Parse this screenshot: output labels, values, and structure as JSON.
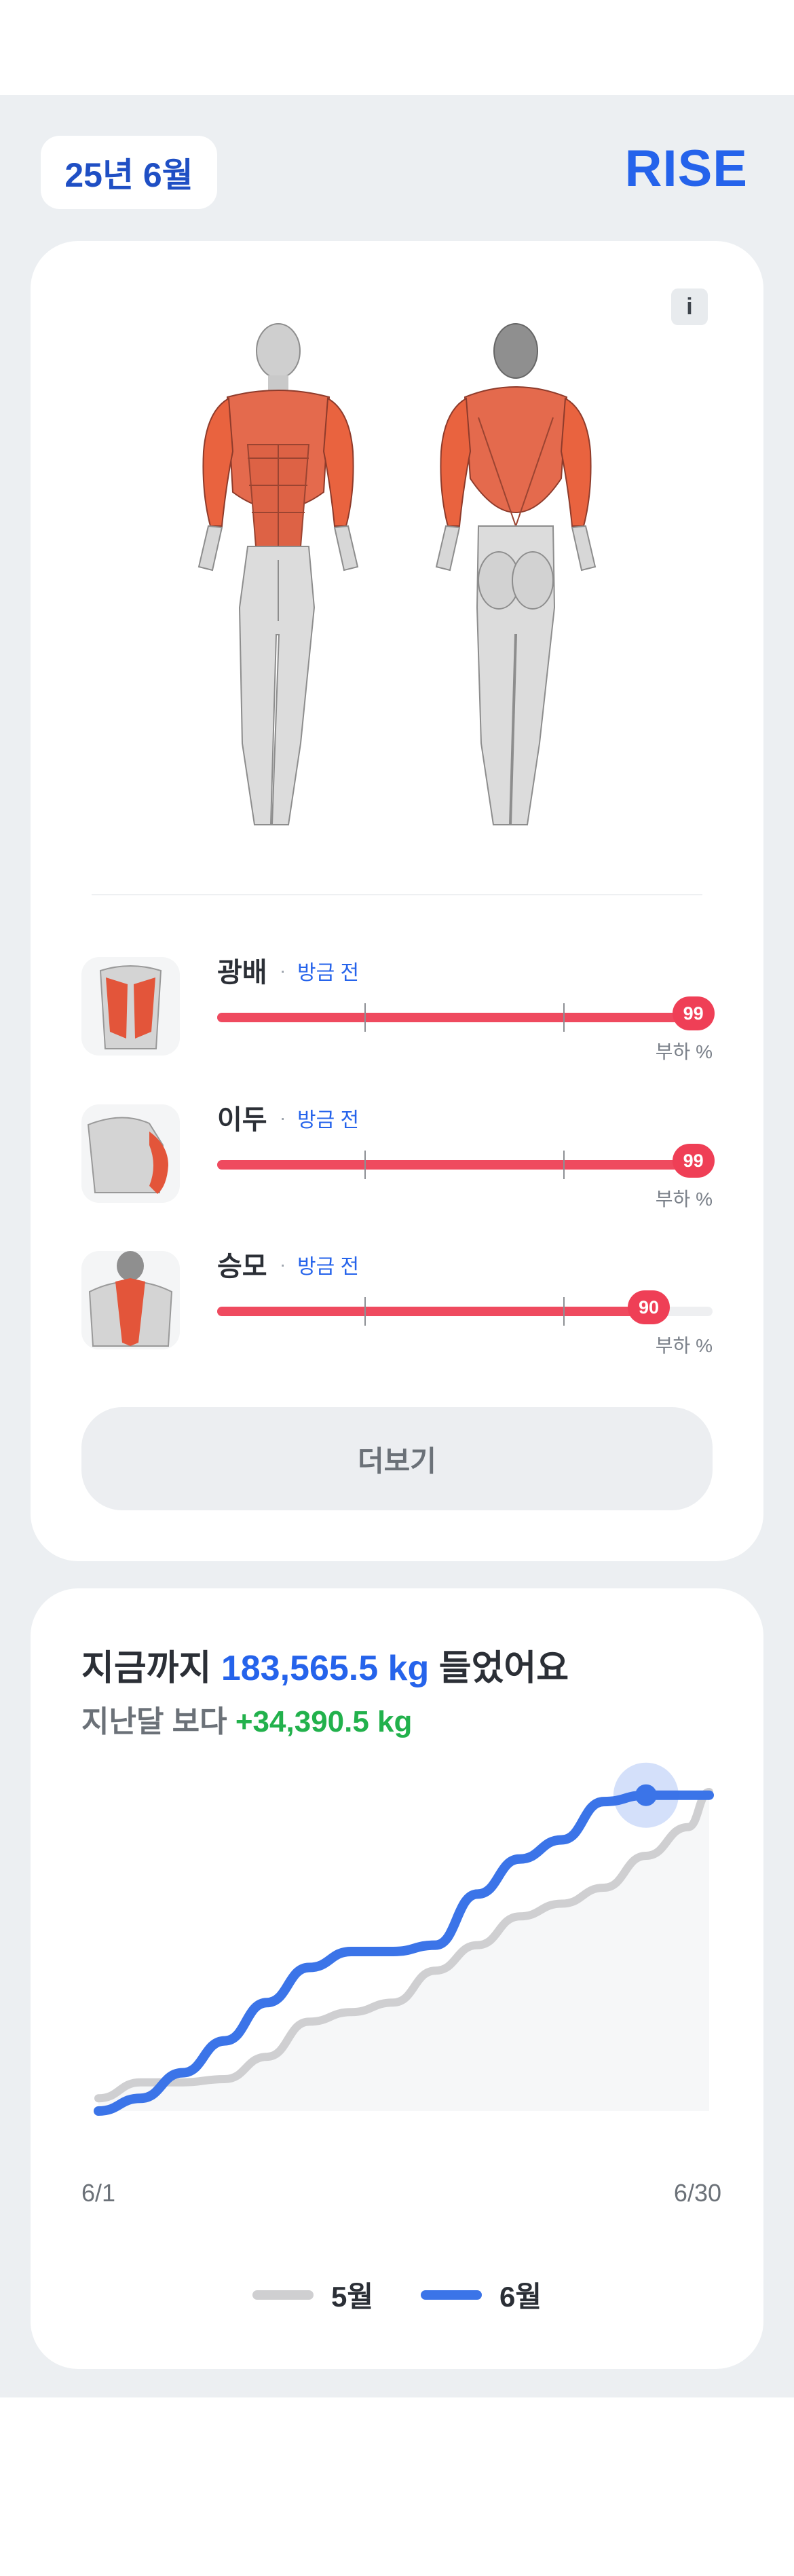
{
  "header": {
    "date_label": "25년 6월",
    "brand": "RISE"
  },
  "body_map": {
    "info_label": "i"
  },
  "muscles": [
    {
      "name": "광배",
      "status": "방금 전",
      "load": 99,
      "unit": "부하 %"
    },
    {
      "name": "이두",
      "status": "방금 전",
      "load": 99,
      "unit": "부하 %"
    },
    {
      "name": "승모",
      "status": "방금 전",
      "load": 90,
      "unit": "부하 %"
    }
  ],
  "more_button": "더보기",
  "total": {
    "prefix": "지금까지 ",
    "amount": "183,565.5 kg",
    "suffix": " 들었어요",
    "compare_prefix": "지난달 보다 ",
    "compare_value": "+34,390.5 kg"
  },
  "chart_data": {
    "type": "line",
    "x_start_label": "6/1",
    "x_end_label": "6/30",
    "x": [
      1,
      3,
      5,
      7,
      9,
      11,
      13,
      15,
      17,
      19,
      21,
      23,
      25,
      27,
      29,
      30
    ],
    "xlim": [
      1,
      30
    ],
    "ylim": [
      0,
      100
    ],
    "series": [
      {
        "name": "5월",
        "color": "#cfcfd1",
        "values": [
          4,
          9,
          9,
          10,
          17,
          28,
          31,
          34,
          44,
          52,
          61,
          65,
          70,
          80,
          89,
          100
        ]
      },
      {
        "name": "6월",
        "color": "#3b74e8",
        "values": [
          0,
          4,
          12,
          22,
          34,
          45,
          50,
          50,
          52,
          68,
          79,
          85,
          97,
          99,
          99,
          99
        ]
      }
    ],
    "grid": false,
    "legend": "bottom"
  },
  "colors": {
    "accent": "#2563eb",
    "load": "#ef4a5f",
    "increase": "#22b14c"
  }
}
